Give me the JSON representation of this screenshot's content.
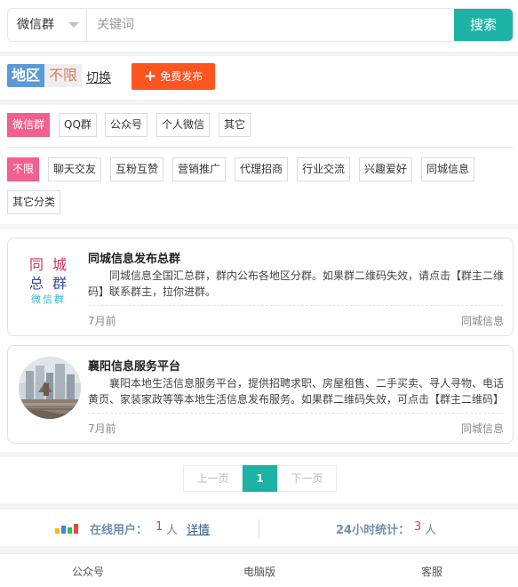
{
  "search": {
    "select_value": "微信群",
    "placeholder": "关键词",
    "button_label": "搜索"
  },
  "region": {
    "label": "地区",
    "value": "不限",
    "switch_label": "切换",
    "publish_label": "免费发布"
  },
  "filters": {
    "types": [
      {
        "label": "微信群",
        "active": true
      },
      {
        "label": "QQ群",
        "active": false
      },
      {
        "label": "公众号",
        "active": false
      },
      {
        "label": "个人微信",
        "active": false
      },
      {
        "label": "其它",
        "active": false
      }
    ],
    "categories": [
      {
        "label": "不限",
        "active": true
      },
      {
        "label": "聊天交友",
        "active": false
      },
      {
        "label": "互粉互赞",
        "active": false
      },
      {
        "label": "营销推广",
        "active": false
      },
      {
        "label": "代理招商",
        "active": false
      },
      {
        "label": "行业交流",
        "active": false
      },
      {
        "label": "兴趣爱好",
        "active": false
      },
      {
        "label": "同城信息",
        "active": false
      },
      {
        "label": "其它分类",
        "active": false
      }
    ]
  },
  "listings": [
    {
      "logo_lines": [
        "同城",
        "总群",
        "微信群"
      ],
      "title": "同城信息发布总群",
      "description": "同城信息全国汇总群，群内公布各地区分群。如果群二维码失效，请点击【群主二维码】联系群主，拉你进群。",
      "time": "7月前",
      "category": "同城信息"
    },
    {
      "logo_image": "city-buildings-photo",
      "title": "襄阳信息服务平台",
      "description": "襄阳本地生活信息服务平台，提供招聘求职、房屋租售、二手买卖、寻人寻物、电话黄页、家装家政等等本地生活信息发布服务。如果群二维码失效，可点击【群主二维码】联系群主。",
      "time": "7月前",
      "category": "同城信息"
    }
  ],
  "pagination": {
    "prev_label": "上一页",
    "current": "1",
    "next_label": "下一页"
  },
  "stats": {
    "online_label": "在线用户：",
    "online_count": "1",
    "unit": "人",
    "detail_link": "详情",
    "daily_label": "24小时统计：",
    "daily_count": "3"
  },
  "bottom_nav": [
    "公众号",
    "电脑版",
    "客服"
  ],
  "colors": {
    "accent": "#1db3a4",
    "publish": "#fd5520",
    "active_tag": "#f2608f",
    "region_label": "#5b9bd5"
  }
}
